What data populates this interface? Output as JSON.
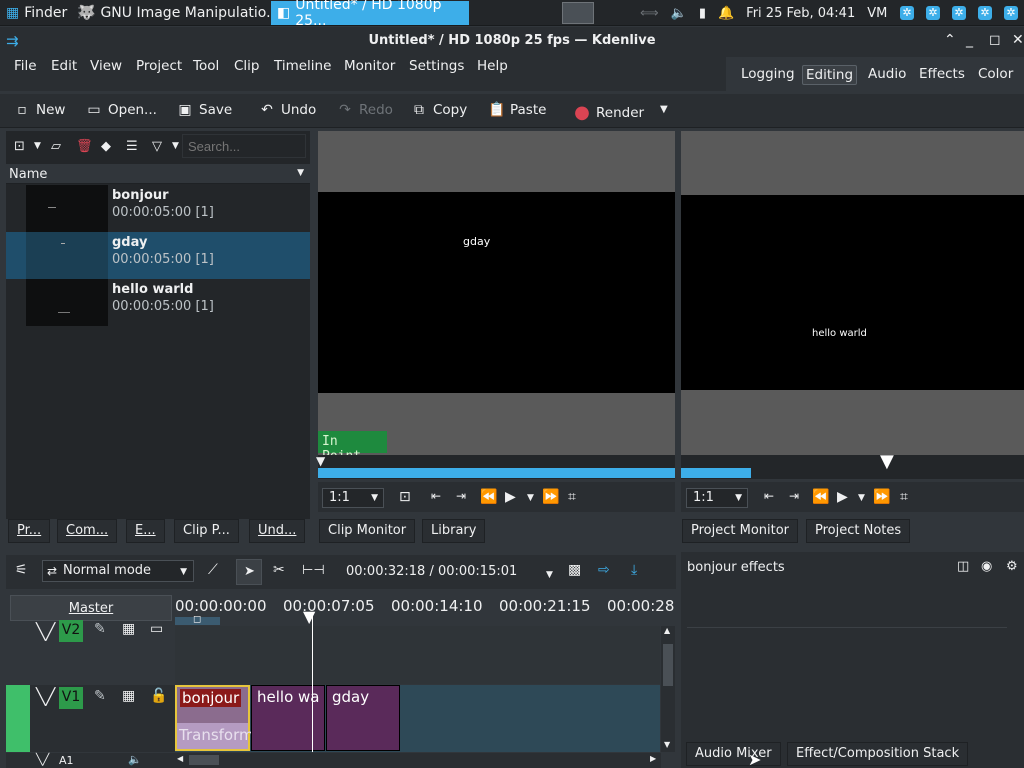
{
  "taskbar": {
    "tasks": [
      "Finder",
      "GNU Image Manipulatio...",
      "Untitled* / HD 1080p 25..."
    ],
    "clock": "Fri 25 Feb, 04:41",
    "user": "VM"
  },
  "window": {
    "title": "Untitled* / HD 1080p 25 fps — Kdenlive"
  },
  "menu": [
    "File",
    "Edit",
    "View",
    "Project",
    "Tool",
    "Clip",
    "Timeline",
    "Monitor",
    "Settings",
    "Help"
  ],
  "workspaces": [
    "Logging",
    "Editing",
    "Audio",
    "Effects",
    "Color"
  ],
  "toolbar": {
    "new": "New",
    "open": "Open...",
    "save": "Save",
    "undo": "Undo",
    "redo": "Redo",
    "copy": "Copy",
    "paste": "Paste",
    "render": "Render"
  },
  "bin": {
    "search_placeholder": "Search...",
    "column_name": "Name",
    "clips": [
      {
        "name": "bonjour",
        "duration": "00:00:05:00 [1]"
      },
      {
        "name": "gday",
        "duration": "00:00:05:00 [1]"
      },
      {
        "name": "hello warld",
        "duration": "00:00:05:00 [1]"
      }
    ],
    "tabs": [
      "Pr...",
      "Com...",
      "E...",
      "Clip P...",
      "Und..."
    ]
  },
  "clip_monitor": {
    "overlay_text": "gday",
    "in_point": "In Point",
    "zoom": "1:1",
    "tabs": [
      "Clip Monitor",
      "Library"
    ]
  },
  "project_monitor": {
    "overlay_text": "hello warld",
    "zoom": "1:1",
    "tabs": [
      "Project Monitor",
      "Project Notes"
    ]
  },
  "effects": {
    "title": "bonjour effects",
    "tabs": [
      "Audio Mixer",
      "Effect/Composition Stack"
    ]
  },
  "timeline": {
    "mode": "Normal mode",
    "timecode": "00:00:32:18 / 00:00:15:01",
    "master": "Master",
    "ticks": [
      "00:00:00:00",
      "00:00:07:05",
      "00:00:14:10",
      "00:00:21:15",
      "00:00:28"
    ],
    "tracks": [
      "V2",
      "V1",
      "A1"
    ],
    "clips": {
      "bonjour": "bonjour",
      "transform": "Transform",
      "hello": "hello wa",
      "gday": "gday"
    }
  },
  "colors": {
    "accent": "#3daee9",
    "track_green": "#2d9a4a",
    "clip_bonjour": "#8b1a1a",
    "clip_purple": "#5a2a5a"
  }
}
